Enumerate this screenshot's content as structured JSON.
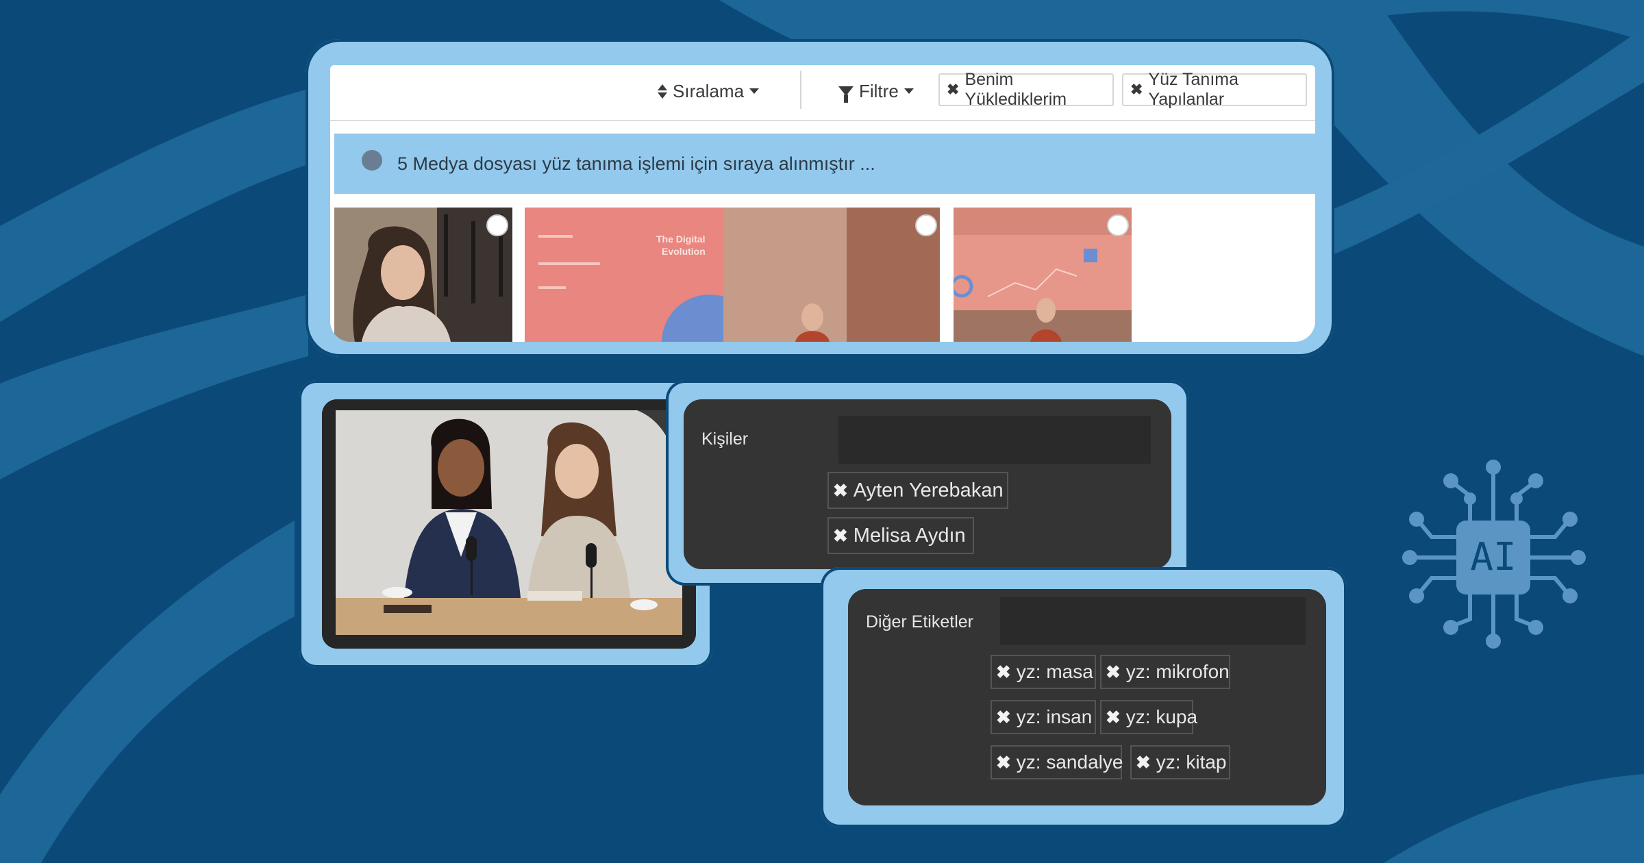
{
  "toolbar": {
    "sort_label": "Sıralama",
    "filter_label": "Filtre",
    "chips": [
      {
        "label": "Benim Yüklediklerim"
      },
      {
        "label": "Yüz Tanıma Yapılanlar"
      }
    ]
  },
  "notice": {
    "text": "5 Medya dosyası yüz tanıma işlemi için sıraya alınmıştır ..."
  },
  "thumbnails": [
    {
      "presentation_line1": "",
      "presentation_line2": ""
    },
    {
      "presentation_line1": "The Digital",
      "presentation_line2": "Evolution"
    },
    {
      "presentation_line1": "",
      "presentation_line2": ""
    }
  ],
  "people": {
    "label": "Kişiler",
    "tags": [
      "Ayten Yerebakan",
      "Melisa Aydın"
    ]
  },
  "other_tags": {
    "label": "Diğer Etiketler",
    "tags": [
      "yz: masa",
      "yz: mikrofon",
      "yz: insan",
      "yz: kupa",
      "yz: sandalye",
      "yz: kitap"
    ]
  },
  "ai_badge": {
    "label": "AI"
  },
  "colors": {
    "background": "#0b4a78",
    "panel": "#92c9ec",
    "dark": "#343434",
    "accent_light": "#1c6797"
  },
  "icons": {
    "sort": "sort-updown-icon",
    "filter": "funnel-icon",
    "remove": "close-x-icon",
    "status": "status-dot-icon",
    "ai": "ai-chip-icon"
  }
}
